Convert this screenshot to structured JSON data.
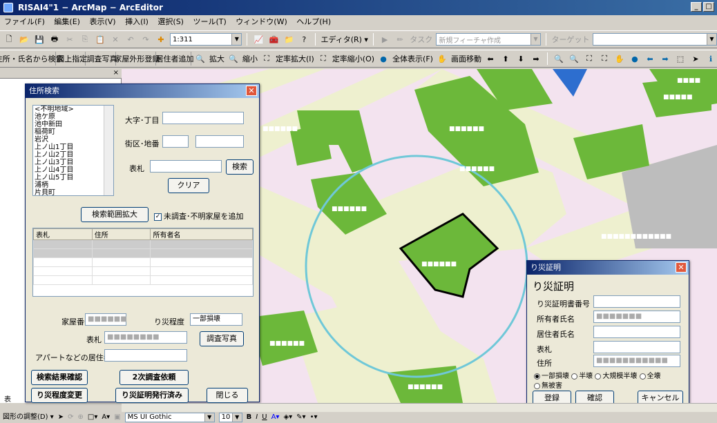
{
  "window": {
    "title": "RISAI4\"1 − ArcMap − ArcEditor",
    "minimize": "_",
    "maximize": "□"
  },
  "menubar": [
    "ファイル(F)",
    "編集(E)",
    "表示(V)",
    "挿入(I)",
    "選択(S)",
    "ツール(T)",
    "ウィンドウ(W)",
    "ヘルプ(H)"
  ],
  "toolbar1": {
    "scale": "1:311",
    "editor_label": "エディタ(R) ▾",
    "task_label": "タスク",
    "task_value": "新規フィーチャ作成",
    "target_label": "ターゲット"
  },
  "toolbar2": {
    "buttons": [
      "住所・氏名から検索",
      "図上指定",
      "調査写真",
      "家屋外形登録",
      "居住者追加"
    ],
    "zoom_in": "拡大",
    "zoom_out": "縮小",
    "fixed_in": "定率拡大(I)",
    "fixed_out": "定率縮小(O)",
    "full_extent": "全体表示(F)",
    "pan": "画面移動"
  },
  "address_dialog": {
    "title": "住所検索",
    "area_list": [
      "<不明地域>",
      "池ケ原",
      "池中新田",
      "稲荷町",
      "岩沢",
      "上ノ山1丁目",
      "上ノ山2丁目",
      "上ノ山3丁目",
      "上ノ山4丁目",
      "上ノ山5丁目",
      "浦柄",
      "片貝町"
    ],
    "oaza_label": "大字･丁目",
    "gaiku_label": "街区･地番",
    "hyosatsu_label": "表札",
    "search_button": "検索",
    "clear_button": "クリア",
    "expand_button": "検索範囲拡大",
    "include_unsurveyed": "未調査･不明家屋を追加",
    "columns": [
      "表札",
      "住所",
      "所有者名"
    ],
    "kaoku_label": "家屋番号",
    "kaoku_value": "■■■■■■",
    "damage_label": "り災程度",
    "damage_value": "一部損壊",
    "hyosatsu2_label": "表札",
    "hyosatsu2_value": "■■■■■■■■",
    "photo_button": "調査写真",
    "resident_label": "アパートなどの居住者",
    "confirm_button": "検索結果確認",
    "second_survey_button": "2次調査依頼",
    "change_button": "り災程度変更",
    "issued_button": "り災証明発行済み",
    "close_button": "閉じる"
  },
  "cert_dialog": {
    "title": "り災証明",
    "heading": "り災証明",
    "cert_no_label": "り災証明書番号",
    "owner_label": "所有者氏名",
    "owner_value": "■■■■■■■",
    "resident_label": "居住者氏名",
    "hyosatsu_label": "表札",
    "address_label": "住所",
    "address_value": "■■■■■■■■■■■",
    "options": [
      "一部損壊",
      "半壊",
      "大規模半壊",
      "全壊",
      "無被害"
    ],
    "register_button": "登録",
    "confirm_button": "確認",
    "cancel_button": "キャンセル"
  },
  "map_labels": [
    "■■■■■■",
    "■■■■■■",
    "■■■■■■",
    "■■■■■■",
    "■■■■■■",
    "■■■■■■",
    "■■■■■■",
    "■■■■■■■■■■■■",
    "■■■■■",
    "■■■■"
  ],
  "drawbar": {
    "draw_label": "図形の調整(D) ▾",
    "font": "MS UI Gothic",
    "size": "10",
    "bold": "B",
    "italic": "I",
    "underline": "U"
  },
  "toc_label": "表",
  "colors": {
    "map_bg": "#f3e3ef",
    "road": "#eef0cf",
    "building": "#6cb83a",
    "circle": "#6fc8d8",
    "title_bar": "#0a246a"
  }
}
